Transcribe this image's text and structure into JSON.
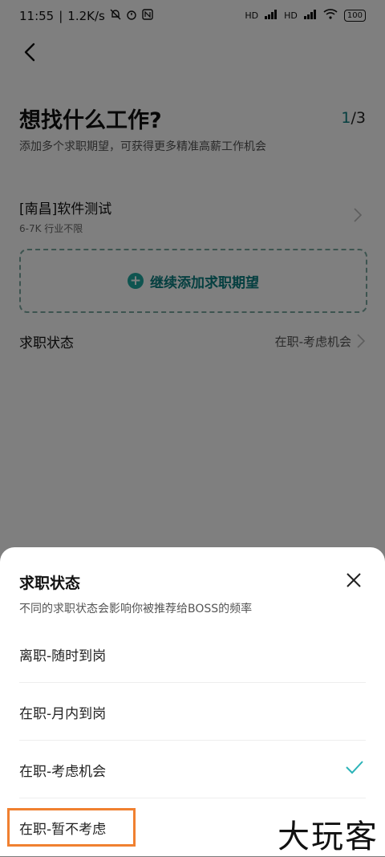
{
  "status_bar": {
    "time": "11:55",
    "speed": "1.2K/s",
    "battery": "100",
    "signal1": "HD",
    "signal2": "HD"
  },
  "header": {
    "title": "想找什么工作?",
    "step_current": "1",
    "step_total": "/3",
    "subtitle": "添加多个求职期望，可获得更多精准高薪工作机会"
  },
  "expectation": {
    "title": "[南昌]软件测试",
    "detail": "6-7K 行业不限"
  },
  "add_expectation": {
    "label": "继续添加求职期望"
  },
  "job_status_row": {
    "label": "求职状态",
    "value": "在职-考虑机会"
  },
  "sheet": {
    "title": "求职状态",
    "description": "不同的求职状态会影响你被推荐给BOSS的频率",
    "options": [
      {
        "label": "离职-随时到岗",
        "selected": false
      },
      {
        "label": "在职-月内到岗",
        "selected": false
      },
      {
        "label": "在职-考虑机会",
        "selected": true
      },
      {
        "label": "在职-暂不考虑",
        "selected": false
      }
    ]
  },
  "watermark": "大玩客",
  "colors": {
    "accent": "#0b7f80",
    "accent_light": "#1fa9a0",
    "highlight": "#f08030",
    "check": "#2bb3b8"
  }
}
